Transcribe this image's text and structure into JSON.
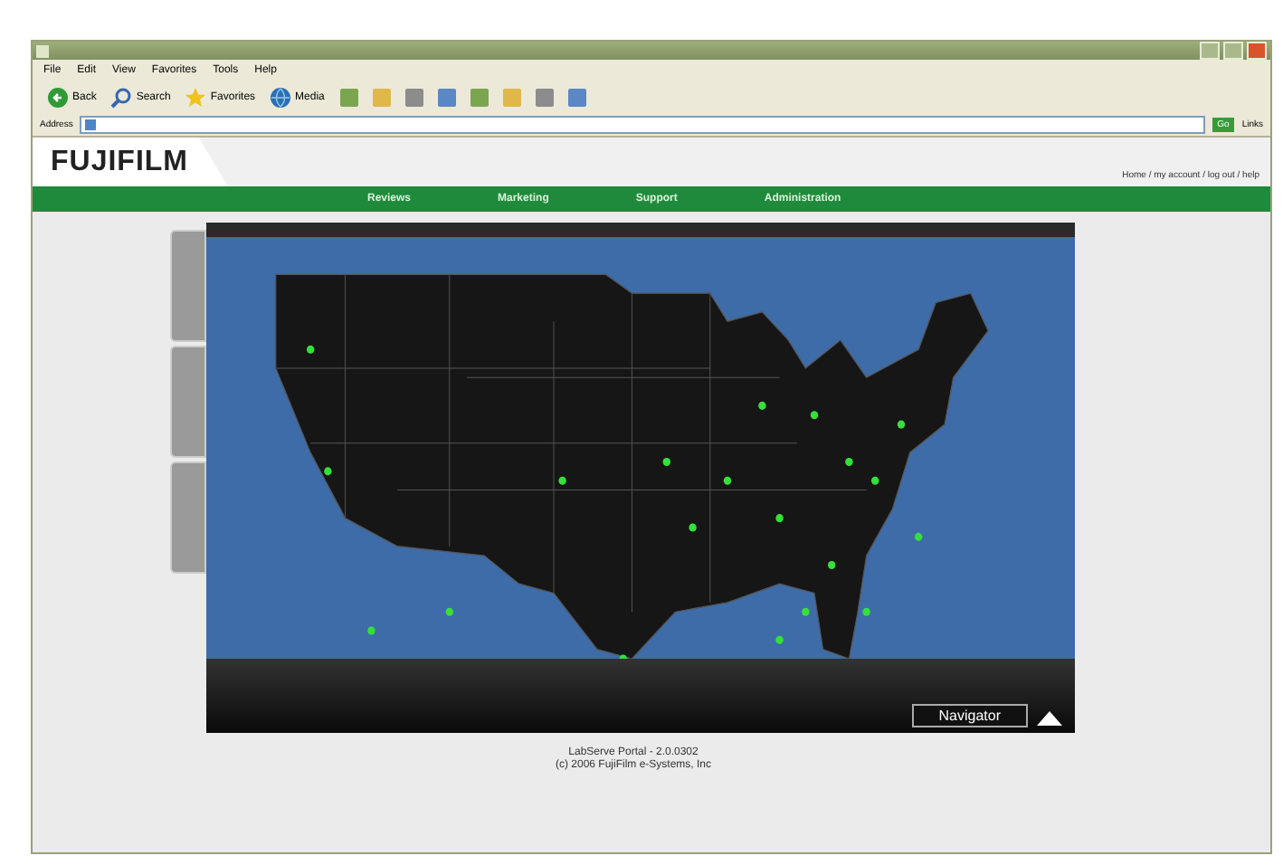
{
  "browser": {
    "menu": [
      "File",
      "Edit",
      "View",
      "Favorites",
      "Tools",
      "Help"
    ],
    "toolbar": [
      {
        "kind": "back",
        "label": "Back"
      },
      {
        "kind": "search",
        "label": "Search"
      },
      {
        "kind": "favorites",
        "label": "Favorites"
      },
      {
        "kind": "media",
        "label": "Media"
      }
    ],
    "address_label": "Address",
    "go": "Go",
    "links": "Links"
  },
  "header": {
    "logo": "FUJIFILM",
    "user_links": "Home / my account / log out / help"
  },
  "nav": [
    {
      "label": "Reviews"
    },
    {
      "label": "Marketing"
    },
    {
      "label": "Support"
    },
    {
      "label": "Administration"
    }
  ],
  "map": {
    "navigator": "Navigator"
  },
  "footer": [
    "LabServe Portal - 2.0.0302",
    "(c) 2006 FujiFilm e-Systems, Inc"
  ]
}
